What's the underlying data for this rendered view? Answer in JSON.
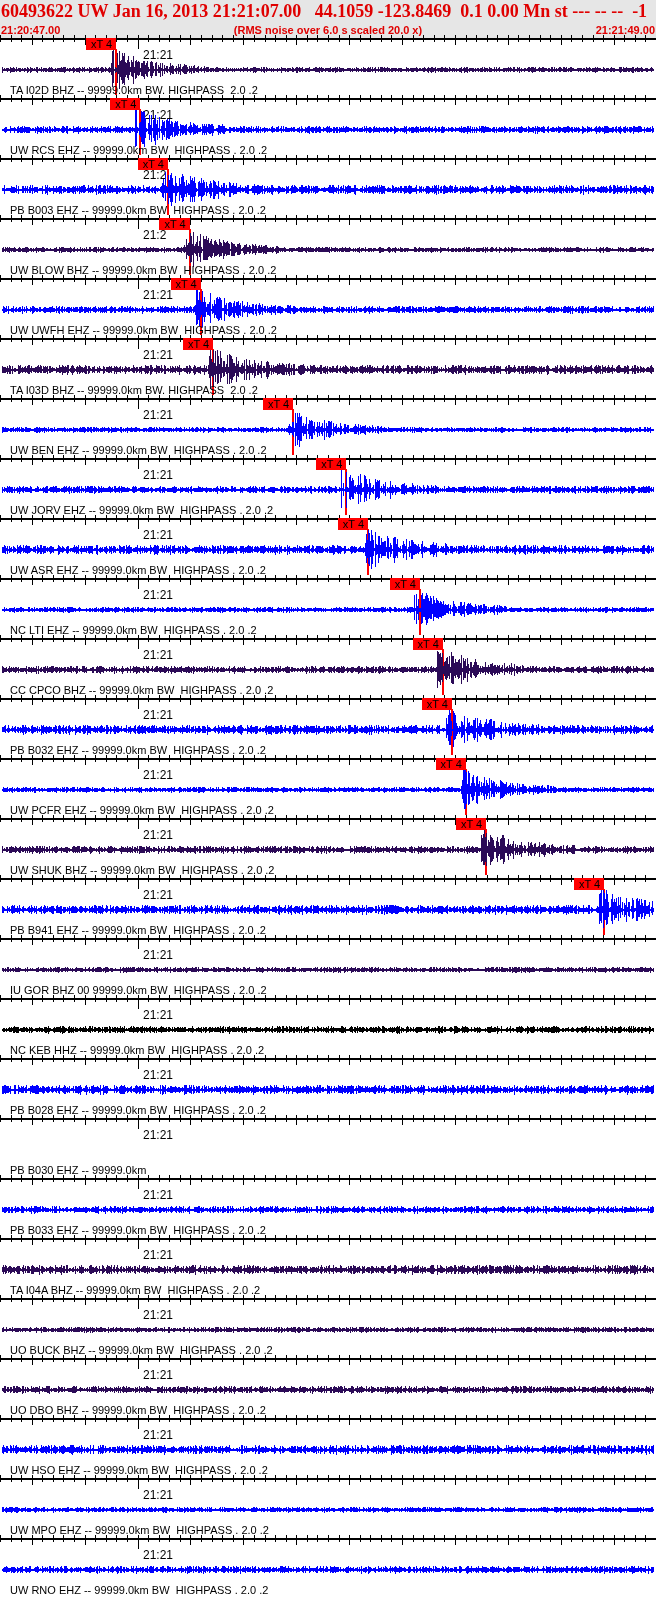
{
  "header": {
    "title": "60493622 UW Jan 16, 2013 21:21:07.00   44.1059 -123.8469  0.1 0.00 Mn st --- -- --  -1",
    "start_time": "21:20:47.00",
    "note": "(RMS noise over 6.0 s scaled 20.0 x)",
    "end_time": "21:21:49.00"
  },
  "traces": [
    {
      "label": "TA I02D BHZ -- 99999.0km BW. HIGHPASS  2.0 .2",
      "time_label": "21:21",
      "color": "#2b0a57",
      "pick": {
        "label": "xT 4",
        "level": 0.177
      }
    },
    {
      "label": "UW RCS EHZ -- 99999.0km BW  HIGHPASS . 2.0 .2",
      "time_label": "21:21",
      "color": "#0000ff",
      "pick": {
        "label": "xT 4",
        "level": 0.214
      }
    },
    {
      "label": "PB B003 EHZ -- 99999.0km BW  HIGHPASS . 2.0 .2",
      "time_label": "21:2",
      "color": "#0000ff",
      "pick": {
        "label": "xT 4",
        "level": 0.256
      }
    },
    {
      "label": "UW BLOW BHZ -- 99999.0km BW  HIGHPASS . 2.0 .2",
      "time_label": "21:2",
      "color": "#2b0a57",
      "pick": {
        "label": "xT 4",
        "level": 0.289
      }
    },
    {
      "label": "UW UWFH EHZ -- 99999.0km BW  HIGHPASS . 2.0 .2",
      "time_label": "21:21",
      "color": "#0000ff",
      "pick": {
        "label": "xT 4",
        "level": 0.306
      }
    },
    {
      "label": "TA I03D BHZ -- 99999.0km BW. HIGHPASS  2.0 .2",
      "time_label": "21:21",
      "color": "#2b0a57",
      "pick": {
        "label": "xT 4",
        "level": 0.325
      }
    },
    {
      "label": "UW BEN EHZ -- 99999.0km BW  HIGHPASS . 2.0 .2",
      "time_label": "21:21",
      "color": "#0000ff",
      "pick": {
        "label": "xT 4",
        "level": 0.447
      }
    },
    {
      "label": "UW JORV EHZ -- 99999.0km BW  HIGHPASS . 2.0 .2",
      "time_label": "21:21",
      "color": "#0000ff",
      "pick": {
        "label": "xT 4",
        "level": 0.528
      }
    },
    {
      "label": "UW ASR EHZ -- 99999.0km BW  HIGHPASS . 2.0 .2",
      "time_label": "21:21",
      "color": "#0000ff",
      "pick": {
        "label": "xT 4",
        "level": 0.561
      }
    },
    {
      "label": "NC LTI EHZ -- 99999.0km BW  HIGHPASS . 2.0 .2",
      "time_label": "21:21",
      "color": "#0000ff",
      "pick": {
        "label": "xT 4",
        "level": 0.64
      }
    },
    {
      "label": "CC CPCO BHZ -- 99999.0km BW  HIGHPASS . 2.0 .2",
      "time_label": "21:21",
      "color": "#2b0a57",
      "pick": {
        "label": "xT 4",
        "level": 0.675
      }
    },
    {
      "label": "PB B032 EHZ -- 99999.0km BW  HIGHPASS . 2.0 .2",
      "time_label": "21:21",
      "color": "#0000ff",
      "pick": {
        "label": "xT 4",
        "level": 0.689
      }
    },
    {
      "label": "UW PCFR EHZ -- 99999.0km BW  HIGHPASS . 2.0 .2",
      "time_label": "21:21",
      "color": "#0000ff",
      "pick": {
        "label": "xT 4",
        "level": 0.71
      }
    },
    {
      "label": "UW SHUK BHZ -- 99999.0km BW  HIGHPASS . 2.0 .2",
      "time_label": "21:21",
      "color": "#2b0a57",
      "pick": {
        "label": "xT 4",
        "level": 0.741
      }
    },
    {
      "label": "PB B941 EHZ -- 99999.0km BW  HIGHPASS . 2.0 .2",
      "time_label": "21:21",
      "color": "#0000ff",
      "pick": {
        "label": "xT 4",
        "level": 0.921
      }
    },
    {
      "label": "IU GOR BHZ 00 99999.0km BW  HIGHPASS . 2.0 .2",
      "time_label": "21:21",
      "color": "#2b0a57"
    },
    {
      "label": "NC KEB HHZ -- 99999.0km BW  HIGHPASS . 2.0 .2",
      "time_label": "21:21",
      "color": "#000000"
    },
    {
      "label": "PB B028 EHZ -- 99999.0km BW  HIGHPASS . 2.0 .2",
      "time_label": "21:21",
      "color": "#0000ff"
    },
    {
      "label": "PB B030 EHZ -- 99999.0km",
      "time_label": "21:21"
    },
    {
      "label": "PB B033 EHZ -- 99999.0km BW  HIGHPASS . 2.0 .2",
      "time_label": "21:21",
      "color": "#0000ff"
    },
    {
      "label": "TA I04A BHZ -- 99999.0km BW  HIGHPASS . 2.0 .2",
      "time_label": "21:21",
      "color": "#2b0a57"
    },
    {
      "label": "UO BUCK BHZ -- 99999.0km BW  HIGHPASS . 2.0 .2",
      "time_label": "21:21",
      "color": "#2b0a57"
    },
    {
      "label": "UO DBO BHZ -- 99999.0km BW  HIGHPASS . 2.0 .2",
      "time_label": "21:21",
      "color": "#2b0a57"
    },
    {
      "label": "UW HSO EHZ -- 99999.0km BW  HIGHPASS . 2.0 .2",
      "time_label": "21:21",
      "color": "#0000ff"
    },
    {
      "label": "UW MPO EHZ -- 99999.0km BW  HIGHPASS . 2.0 .2",
      "time_label": "21:21",
      "color": "#0000ff"
    },
    {
      "label": "UW RNO EHZ -- 99999.0km BW  HIGHPASS . 2.0 .2",
      "time_label": "21:21",
      "color": "#0000ff"
    }
  ]
}
